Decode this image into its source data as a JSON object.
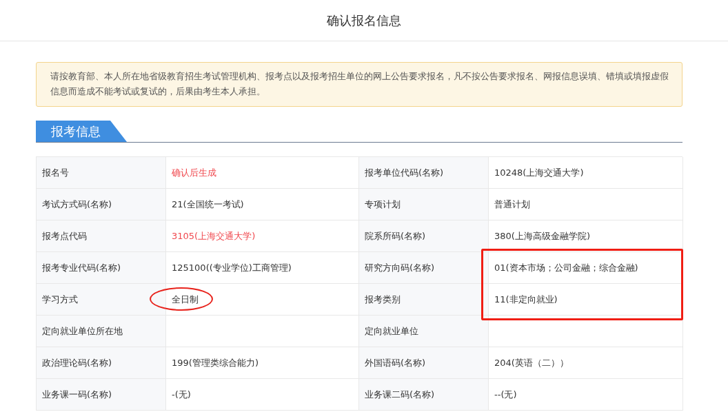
{
  "page_title": "确认报名信息",
  "notice": "请按教育部、本人所在地省级教育招生考试管理机构、报考点以及报考招生单位的网上公告要求报名，凡不按公告要求报名、网报信息误填、错填或填报虚假信息而造成不能考试或复试的，后果由考生本人承担。",
  "section_title": "报考信息",
  "rows": [
    {
      "cells": [
        {
          "label": "报名号",
          "value": "确认后生成",
          "emphasis": true,
          "circled": false,
          "framed": false
        },
        {
          "label": "报考单位代码(名称)",
          "value": "10248(上海交通大学)",
          "emphasis": false,
          "circled": false,
          "framed": false
        }
      ]
    },
    {
      "cells": [
        {
          "label": "考试方式码(名称)",
          "value": "21(全国统一考试)",
          "emphasis": false,
          "circled": false,
          "framed": false
        },
        {
          "label": "专项计划",
          "value": "普通计划",
          "emphasis": false,
          "circled": false,
          "framed": false
        }
      ]
    },
    {
      "cells": [
        {
          "label": "报考点代码",
          "value": "3105(上海交通大学)",
          "emphasis": true,
          "circled": false,
          "framed": false
        },
        {
          "label": "院系所码(名称)",
          "value": "380(上海高级金融学院)",
          "emphasis": false,
          "circled": false,
          "framed": false
        }
      ]
    },
    {
      "cells": [
        {
          "label": "报考专业代码(名称)",
          "value": "125100((专业学位)工商管理)",
          "emphasis": false,
          "circled": false,
          "framed": false
        },
        {
          "label": "研究方向码(名称)",
          "value": "01(资本市场；公司金融；综合金融)",
          "emphasis": false,
          "circled": false,
          "framed": true
        }
      ]
    },
    {
      "cells": [
        {
          "label": "学习方式",
          "value": "全日制",
          "emphasis": false,
          "circled": true,
          "framed": false
        },
        {
          "label": "报考类别",
          "value": "11(非定向就业)",
          "emphasis": false,
          "circled": false,
          "framed": true
        }
      ]
    },
    {
      "cells": [
        {
          "label": "定向就业单位所在地",
          "circled": false,
          "framed": false
        },
        {
          "label": "定向就业单位",
          "circled": false,
          "framed": false
        }
      ]
    },
    {
      "cells": [
        {
          "label": "政治理论码(名称)",
          "value": "199(管理类综合能力)",
          "emphasis": false,
          "circled": false,
          "framed": false
        },
        {
          "label": "外国语码(名称)",
          "value": "204(英语（二））",
          "emphasis": false,
          "circled": false,
          "framed": false
        }
      ]
    },
    {
      "cells": [
        {
          "label": "业务课一码(名称)",
          "value": "-(无)",
          "emphasis": false,
          "circled": false,
          "framed": false
        },
        {
          "label": "业务课二码(名称)",
          "value": "--(无)",
          "emphasis": false,
          "circled": false,
          "framed": false
        }
      ]
    }
  ]
}
